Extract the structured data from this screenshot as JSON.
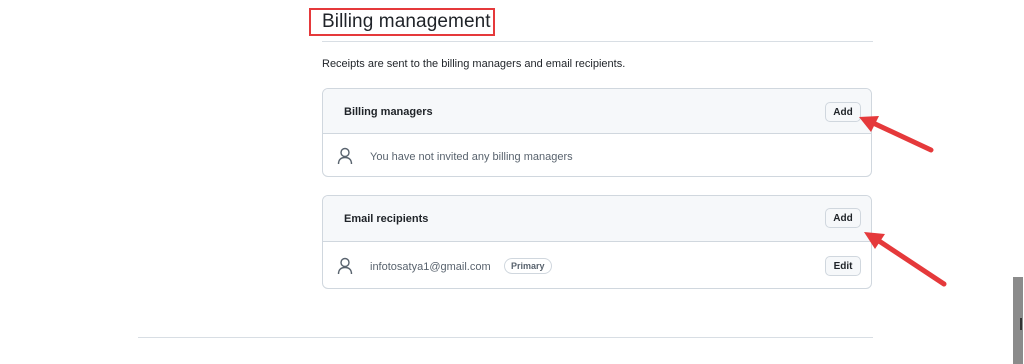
{
  "page": {
    "title": "Billing management",
    "description": "Receipts are sent to the billing managers and email recipients."
  },
  "billing_managers": {
    "heading": "Billing managers",
    "add_label": "Add",
    "empty_text": "You have not invited any billing managers",
    "icon": "person-icon"
  },
  "email_recipients": {
    "heading": "Email recipients",
    "add_label": "Add",
    "entries": [
      {
        "email": "infotosatya1@gmail.com",
        "badge": "Primary",
        "edit_label": "Edit",
        "icon": "person-icon"
      }
    ]
  },
  "annotations": {
    "highlight_color": "#e5393b",
    "arrow_color": "#e5393b"
  }
}
